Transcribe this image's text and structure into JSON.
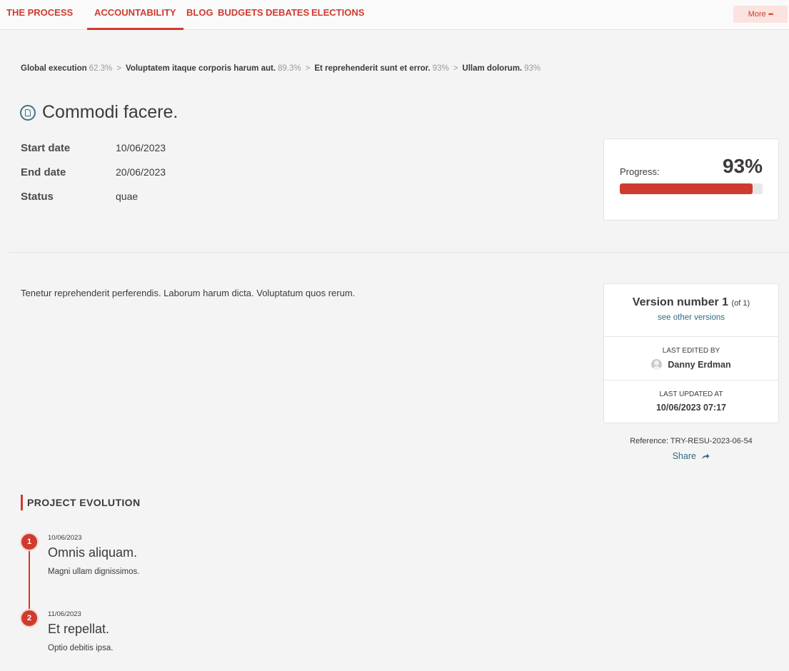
{
  "nav": {
    "tabs": [
      {
        "label": "THE PROCESS"
      },
      {
        "label": "ACCOUNTABILITY"
      },
      {
        "label": "BLOG"
      },
      {
        "label": "BUDGETS"
      },
      {
        "label": "DEBATES"
      },
      {
        "label": "ELECTIONS"
      }
    ],
    "active_tab": "ACCOUNTABILITY",
    "more_label": "More",
    "more_dots": "•••"
  },
  "breadcrumb": [
    {
      "label": "Global execution",
      "percent": "62.3%"
    },
    {
      "label": "Voluptatem itaque corporis harum aut.",
      "percent": "89.3%"
    },
    {
      "label": "Et reprehenderit sunt et error.",
      "percent": "93%"
    },
    {
      "label": "Ullam dolorum.",
      "percent": "93%"
    }
  ],
  "breadcrumb_separator": ">",
  "result": {
    "icon": "document-circle-icon",
    "title": "Commodi facere.",
    "details": [
      {
        "label": "Start date",
        "value": "10/06/2023"
      },
      {
        "label": "End date",
        "value": "20/06/2023"
      },
      {
        "label": "Status",
        "value": "quae"
      }
    ],
    "progress": {
      "label": "Progress:",
      "value_text": "93%",
      "value": 0.93
    },
    "description": "Tenetur reprehenderit perferendis. Laborum harum dicta. Voluptatum quos rerum."
  },
  "version": {
    "title": "Version number",
    "number": "1",
    "of_text": "(of 1)",
    "see_other_link": "see other versions",
    "last_edited_label": "LAST EDITED BY",
    "last_edited_by": "Danny Erdman",
    "last_updated_label": "LAST UPDATED AT",
    "last_updated_at": "10/06/2023 07:17"
  },
  "reference": "Reference: TRY-RESU-2023-06-54",
  "share_label": "Share",
  "evolution": {
    "heading": "PROJECT EVOLUTION",
    "items": [
      {
        "number": "1",
        "date": "10/06/2023",
        "title": "Omnis aliquam.",
        "text": "Magni ullam dignissimos."
      },
      {
        "number": "2",
        "date": "11/06/2023",
        "title": "Et repellat.",
        "text": "Optio debitis ipsa."
      }
    ]
  },
  "colors": {
    "accent": "#cf3b2f",
    "link": "#2f6b7d",
    "background": "#f4f4f4"
  }
}
